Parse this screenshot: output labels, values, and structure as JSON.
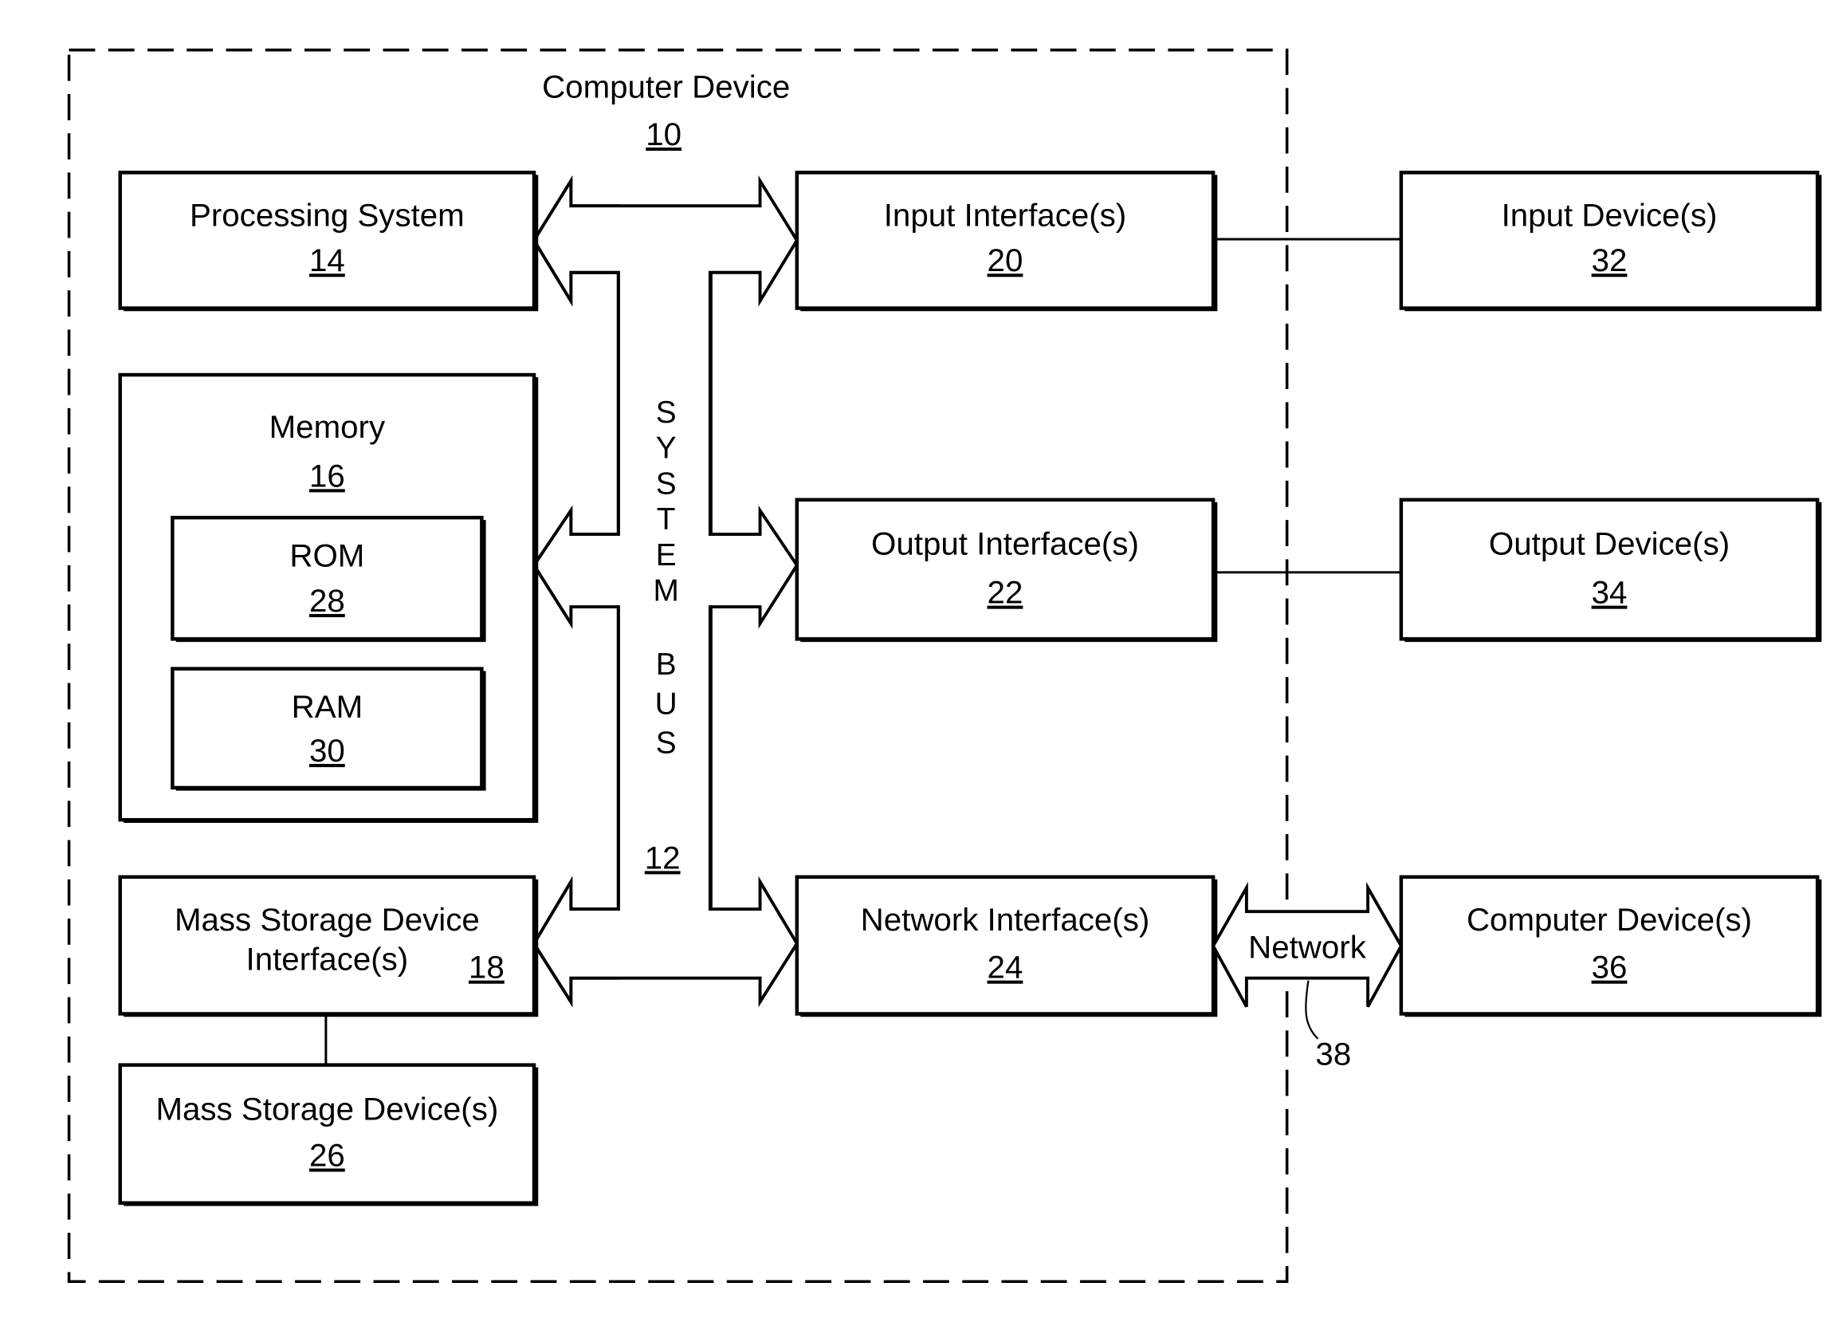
{
  "figure": {
    "container": {
      "title": "Computer Device",
      "ref": "10"
    },
    "system_bus": {
      "letters": [
        "S",
        "Y",
        "S",
        "T",
        "E",
        "M",
        "",
        "B",
        "U",
        "S"
      ],
      "ref": "12"
    },
    "blocks": {
      "processing_system": {
        "label": "Processing System",
        "ref": "14"
      },
      "memory": {
        "label": "Memory",
        "ref": "16"
      },
      "rom": {
        "label": "ROM",
        "ref": "28"
      },
      "ram": {
        "label": "RAM",
        "ref": "30"
      },
      "mass_storage_interface": {
        "label_line1": "Mass Storage Device",
        "label_line2": "Interface(s)",
        "ref": "18"
      },
      "mass_storage_device": {
        "label": "Mass Storage Device(s)",
        "ref": "26"
      },
      "input_interface": {
        "label": "Input Interface(s)",
        "ref": "20"
      },
      "output_interface": {
        "label": "Output Interface(s)",
        "ref": "22"
      },
      "network_interface": {
        "label": "Network Interface(s)",
        "ref": "24"
      },
      "input_device": {
        "label": "Input Device(s)",
        "ref": "32"
      },
      "output_device": {
        "label": "Output Device(s)",
        "ref": "34"
      },
      "remote_computer": {
        "label": "Computer Device(s)",
        "ref": "36"
      }
    },
    "network": {
      "label": "Network",
      "ref": "38"
    }
  }
}
